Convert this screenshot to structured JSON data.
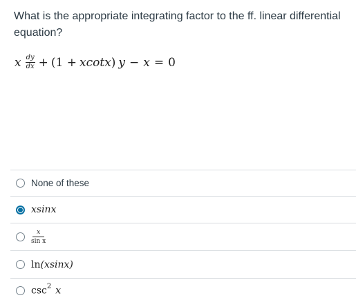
{
  "question": {
    "text": "What is the appropriate integrating factor to the ff. linear differential equation?"
  },
  "equation": {
    "lead": "x",
    "frac_num": "dy",
    "frac_den": "dx",
    "plus": "+",
    "paren_open": "(1 +",
    "xcot": "xcotx",
    "paren_close": ")",
    "y": "y",
    "minus": "−",
    "x2": "x",
    "eq": "=",
    "rhs": "0"
  },
  "answers": [
    {
      "label": "None of these",
      "selected": false
    },
    {
      "label": "xsinx",
      "selected": true
    },
    {
      "num": "x",
      "den": "sin x",
      "selected": false
    },
    {
      "fn": "ln",
      "arg": "(xsinx)",
      "selected": false
    },
    {
      "fn": "csc",
      "exp": "2",
      "arg": "x",
      "selected": false
    }
  ],
  "colors": {
    "text": "#2d3b45",
    "selected_radio": "#0770a3",
    "divider": "#d7dbdf"
  }
}
